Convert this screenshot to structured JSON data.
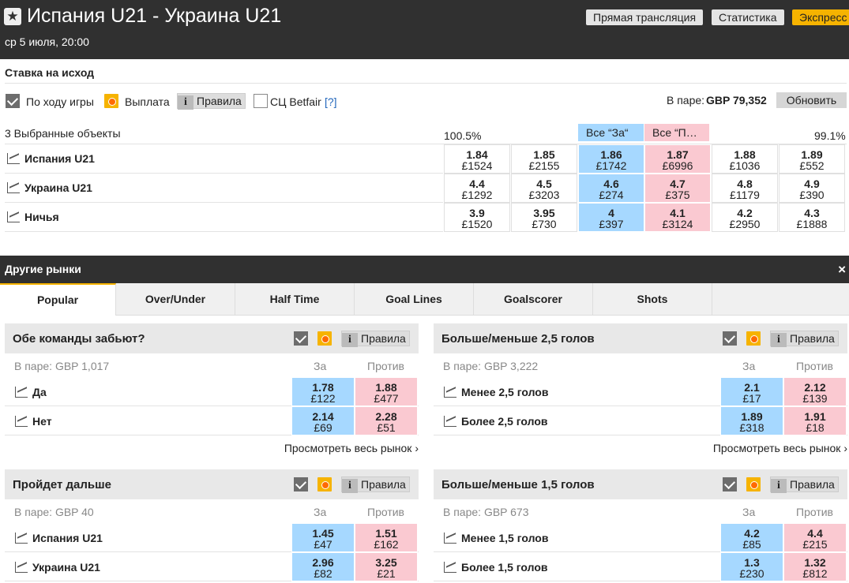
{
  "header": {
    "title": "Испания U21 - Украина U21",
    "datetime": "ср 5 июля, 20:00",
    "buttons": [
      "Прямая трансляция",
      "Статистика",
      "Экспресс"
    ]
  },
  "match_odds": {
    "title": "Ставка на исход",
    "in_play_label": "По ходу игры",
    "payout_label": "Выплата",
    "rules_label": "Правила",
    "bsp_label": "СЦ Betfair",
    "bsp_help": "[?]",
    "matched_label": "В паре:",
    "matched_value": "GBP 79,352",
    "refresh_label": "Обновить",
    "selections_count": "3 Выбранные объекты",
    "back_pct": "100.5%",
    "lay_pct": "99.1%",
    "all_back": "Все “За“",
    "all_lay": "Все “П…",
    "runners": [
      {
        "name": "Испания U21",
        "odds": [
          [
            "1.84",
            "£1524"
          ],
          [
            "1.85",
            "£2155"
          ],
          [
            "1.86",
            "£1742"
          ],
          [
            "1.87",
            "£6996"
          ],
          [
            "1.88",
            "£1036"
          ],
          [
            "1.89",
            "£552"
          ]
        ]
      },
      {
        "name": "Украина U21",
        "odds": [
          [
            "4.4",
            "£1292"
          ],
          [
            "4.5",
            "£3203"
          ],
          [
            "4.6",
            "£274"
          ],
          [
            "4.7",
            "£375"
          ],
          [
            "4.8",
            "£1179"
          ],
          [
            "4.9",
            "£390"
          ]
        ]
      },
      {
        "name": "Ничья",
        "odds": [
          [
            "3.9",
            "£1520"
          ],
          [
            "3.95",
            "£730"
          ],
          [
            "4",
            "£397"
          ],
          [
            "4.1",
            "£3124"
          ],
          [
            "4.2",
            "£2950"
          ],
          [
            "4.3",
            "£1888"
          ]
        ]
      }
    ]
  },
  "other_markets": {
    "title": "Другие рынки",
    "close_icon": "×",
    "tabs": [
      "Popular",
      "Over/Under",
      "Half Time",
      "Goal Lines",
      "Goalscorer",
      "Shots"
    ],
    "back_col": "За",
    "lay_col": "Против",
    "rules_label": "Правила",
    "view_all": "Просмотреть весь рынок",
    "markets": [
      {
        "title": "Обе команды забьют?",
        "matched": "В паре: GBP 1,017",
        "runners": [
          {
            "name": "Да",
            "back": [
              "1.78",
              "£122"
            ],
            "lay": [
              "1.88",
              "£477"
            ]
          },
          {
            "name": "Нет",
            "back": [
              "2.14",
              "£69"
            ],
            "lay": [
              "2.28",
              "£51"
            ]
          }
        ]
      },
      {
        "title": "Больше/меньше 2,5 голов",
        "matched": "В паре: GBP 3,222",
        "runners": [
          {
            "name": "Менее 2,5 голов",
            "back": [
              "2.1",
              "£17"
            ],
            "lay": [
              "2.12",
              "£139"
            ]
          },
          {
            "name": "Более 2,5 голов",
            "back": [
              "1.89",
              "£318"
            ],
            "lay": [
              "1.91",
              "£18"
            ]
          }
        ]
      },
      {
        "title": "Пройдет дальше",
        "matched": "В паре: GBP 40",
        "runners": [
          {
            "name": "Испания U21",
            "back": [
              "1.45",
              "£47"
            ],
            "lay": [
              "1.51",
              "£162"
            ]
          },
          {
            "name": "Украина U21",
            "back": [
              "2.96",
              "£82"
            ],
            "lay": [
              "3.25",
              "£21"
            ]
          }
        ]
      },
      {
        "title": "Больше/меньше 1,5 голов",
        "matched": "В паре: GBP 673",
        "runners": [
          {
            "name": "Менее 1,5 голов",
            "back": [
              "4.2",
              "£85"
            ],
            "lay": [
              "4.4",
              "£215"
            ]
          },
          {
            "name": "Более 1,5 голов",
            "back": [
              "1.3",
              "£230"
            ],
            "lay": [
              "1.32",
              "£812"
            ]
          }
        ]
      }
    ]
  }
}
